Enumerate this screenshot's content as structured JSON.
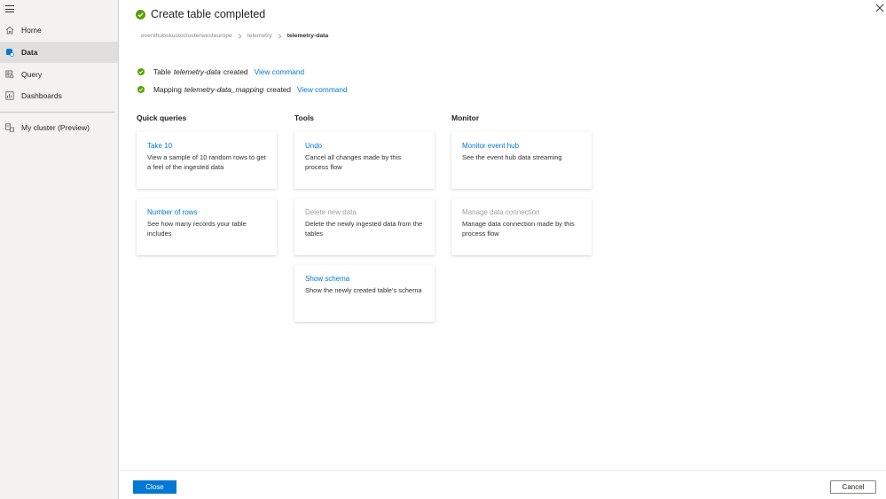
{
  "sidebar": {
    "menu_icon": "hamburger-icon",
    "items": [
      {
        "label": "Home",
        "icon": "home-icon"
      },
      {
        "label": "Data",
        "icon": "data-icon",
        "active": true
      },
      {
        "label": "Query",
        "icon": "query-icon"
      },
      {
        "label": "Dashboards",
        "icon": "dashboards-icon"
      },
      {
        "label": "My cluster (Preview)",
        "icon": "cluster-icon"
      }
    ]
  },
  "header": {
    "title": "Create table completed",
    "breadcrumb": [
      "eventhubskustoclusterwesteurope",
      "telemetry",
      "telemetry-data"
    ]
  },
  "status": [
    {
      "prefix": "Table",
      "name": "telemetry-data",
      "suffix": "created",
      "link": "View command"
    },
    {
      "prefix": "Mapping",
      "name": "telemetry-data_mapping",
      "suffix": "created",
      "link": "View command"
    }
  ],
  "sections": {
    "quick_queries": {
      "title": "Quick queries",
      "cards": [
        {
          "title": "Take 10",
          "desc": "View a sample of 10 random rows to get a feel of the ingested data"
        },
        {
          "title": "Number of rows",
          "desc": "See how many records your table includes"
        }
      ]
    },
    "tools": {
      "title": "Tools",
      "cards": [
        {
          "title": "Undo",
          "desc": "Cancel all changes made by this process flow"
        },
        {
          "title": "Delete new data",
          "desc": "Delete the newly ingested data from the tables",
          "disabled": true
        },
        {
          "title": "Show schema",
          "desc": "Show the newly created table's schema"
        }
      ]
    },
    "monitor": {
      "title": "Monitor",
      "cards": [
        {
          "title": "Monitor event hub",
          "desc": "See the event hub data streaming"
        },
        {
          "title": "Manage data connection",
          "desc": "Manage data connection made by this process flow",
          "disabled": true
        }
      ]
    }
  },
  "footer": {
    "close_label": "Close",
    "cancel_label": "Cancel"
  },
  "colors": {
    "accent": "#0078d4",
    "success": "#57a300",
    "sidebar_bg": "#f3f2f1"
  }
}
